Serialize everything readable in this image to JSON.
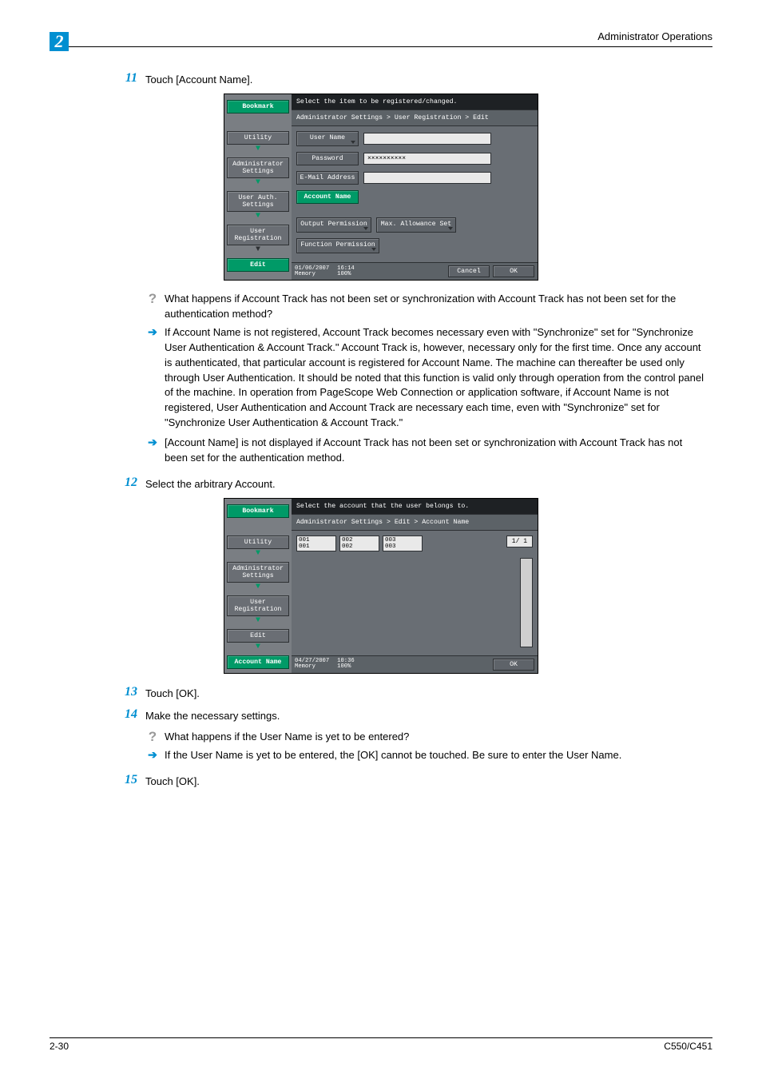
{
  "header": {
    "title": "Administrator Operations",
    "chapter": "2"
  },
  "footer": {
    "page": "2-30",
    "doc": "C550/C451"
  },
  "steps": {
    "s11": {
      "num": "11",
      "text": "Touch [Account Name]."
    },
    "s12": {
      "num": "12",
      "text": "Select the arbitrary Account."
    },
    "s13": {
      "num": "13",
      "text": "Touch [OK]."
    },
    "s14": {
      "num": "14",
      "text": "Make the necessary settings."
    },
    "s15": {
      "num": "15",
      "text": "Touch [OK]."
    }
  },
  "qa": {
    "q1": "What happens if Account Track has not been set or synchronization with Account Track has not been set for the authentication method?",
    "a1": "If Account Name is not registered, Account Track becomes necessary even with \"Synchronize\" set for \"Synchronize User Authentication & Account Track.\" Account Track is, however, necessary only for the first time. Once any account is authenticated, that particular account is registered for Account Name. The machine can thereafter be used only through User Authentication. It should be noted that this function is valid only through operation from the control panel of the machine. In operation from PageScope Web Connection or application software, if Account Name is not registered, User Authentication and Account Track are necessary each time, even with \"Synchronize\" set for \"Synchronize User Authentication & Account Track.\"",
    "a2": "[Account Name] is not displayed if Account Track has not been set or synchronization with Account Track has not been set for the authentication method.",
    "q2": "What happens if the User Name is yet to be entered?",
    "a3": "If the User Name is yet to be entered, the [OK] cannot be touched. Be sure to enter the User Name."
  },
  "shot1": {
    "title": "Select the item to be registered/changed.",
    "crumb": "Administrator Settings > User Registration > Edit",
    "side": {
      "bookmark": "Bookmark",
      "utility": "Utility",
      "admin": "Administrator Settings",
      "userauth": "User Auth. Settings",
      "userreg": "User Registration",
      "edit": "Edit"
    },
    "labels": {
      "user": "User Name",
      "pwd": "Password",
      "email": "E-Mail Address",
      "acct": "Account Name",
      "outperm": "Output Permission",
      "maxallow": "Max. Allowance Set",
      "funcperm": "Function Permission"
    },
    "pwdval": "××××××××××",
    "footer": {
      "date": "01/06/2007",
      "time": "16:14",
      "mem": "Memory",
      "pct": "100%",
      "cancel": "Cancel",
      "ok": "OK"
    }
  },
  "shot2": {
    "title": "Select the account that the user belongs to.",
    "crumb": "Administrator Settings > Edit > Account Name",
    "side": {
      "bookmark": "Bookmark",
      "utility": "Utility",
      "admin": "Administrator Settings",
      "userreg": "User Registration",
      "edit": "Edit",
      "acct": "Account Name"
    },
    "accounts": [
      {
        "id": "001",
        "name": "001"
      },
      {
        "id": "002",
        "name": "002"
      },
      {
        "id": "003",
        "name": "003"
      }
    ],
    "pager": "1/  1",
    "footer": {
      "date": "04/27/2007",
      "time": "10:36",
      "mem": "Memory",
      "pct": "100%",
      "ok": "OK"
    }
  }
}
